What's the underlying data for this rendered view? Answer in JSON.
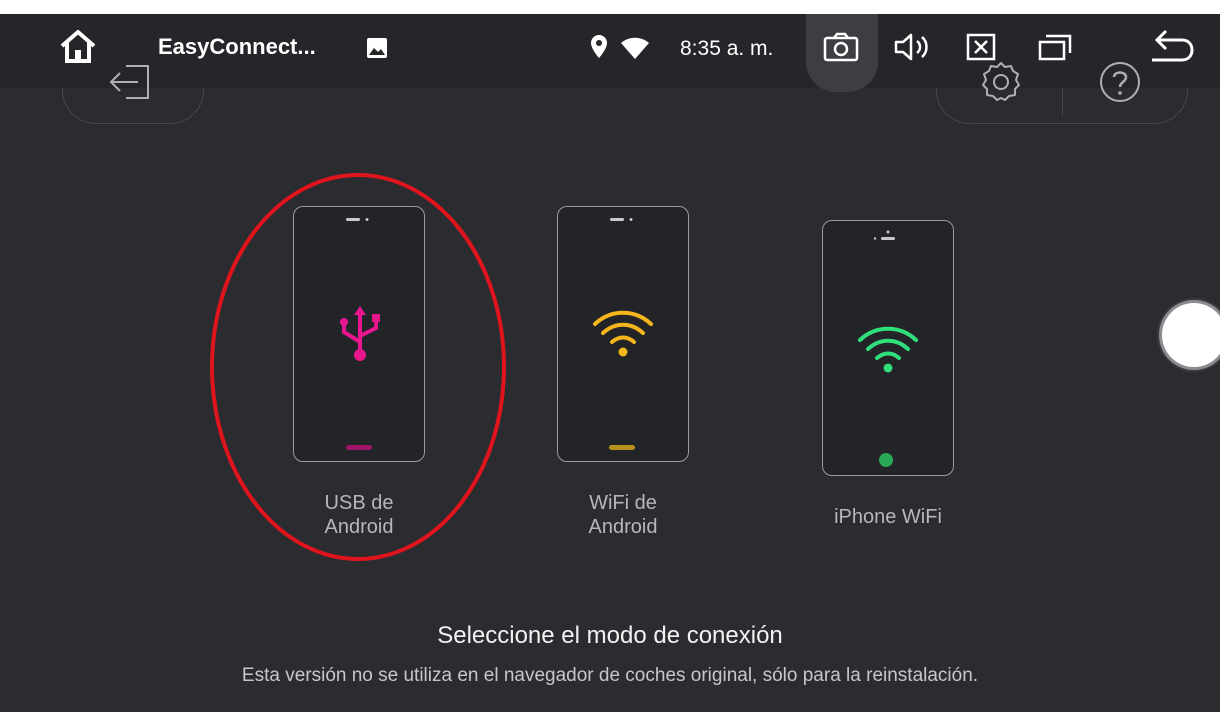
{
  "statusbar": {
    "app_title": "EasyConnect...",
    "time": "8:35 a. m."
  },
  "modes": [
    {
      "label_line1": "USB de",
      "label_line2": "Android",
      "icon": "usb-icon",
      "accent": "#e8158f",
      "indicator": "#a01468"
    },
    {
      "label_line1": "WiFi de",
      "label_line2": "Android",
      "icon": "wifi-icon",
      "accent": "#f5b51c",
      "indicator": "#b8901e"
    },
    {
      "label_line1": "iPhone WiFi",
      "label_line2": "",
      "icon": "wifi-icon",
      "accent": "#2fe07a",
      "indicator": "#2aa855"
    }
  ],
  "selection": {
    "title": "Seleccione el modo de conexión",
    "subtitle": "Esta versión no se utiliza en el navegador de coches original, sólo para la reinstalación."
  },
  "annotation_color": "#e0141c"
}
